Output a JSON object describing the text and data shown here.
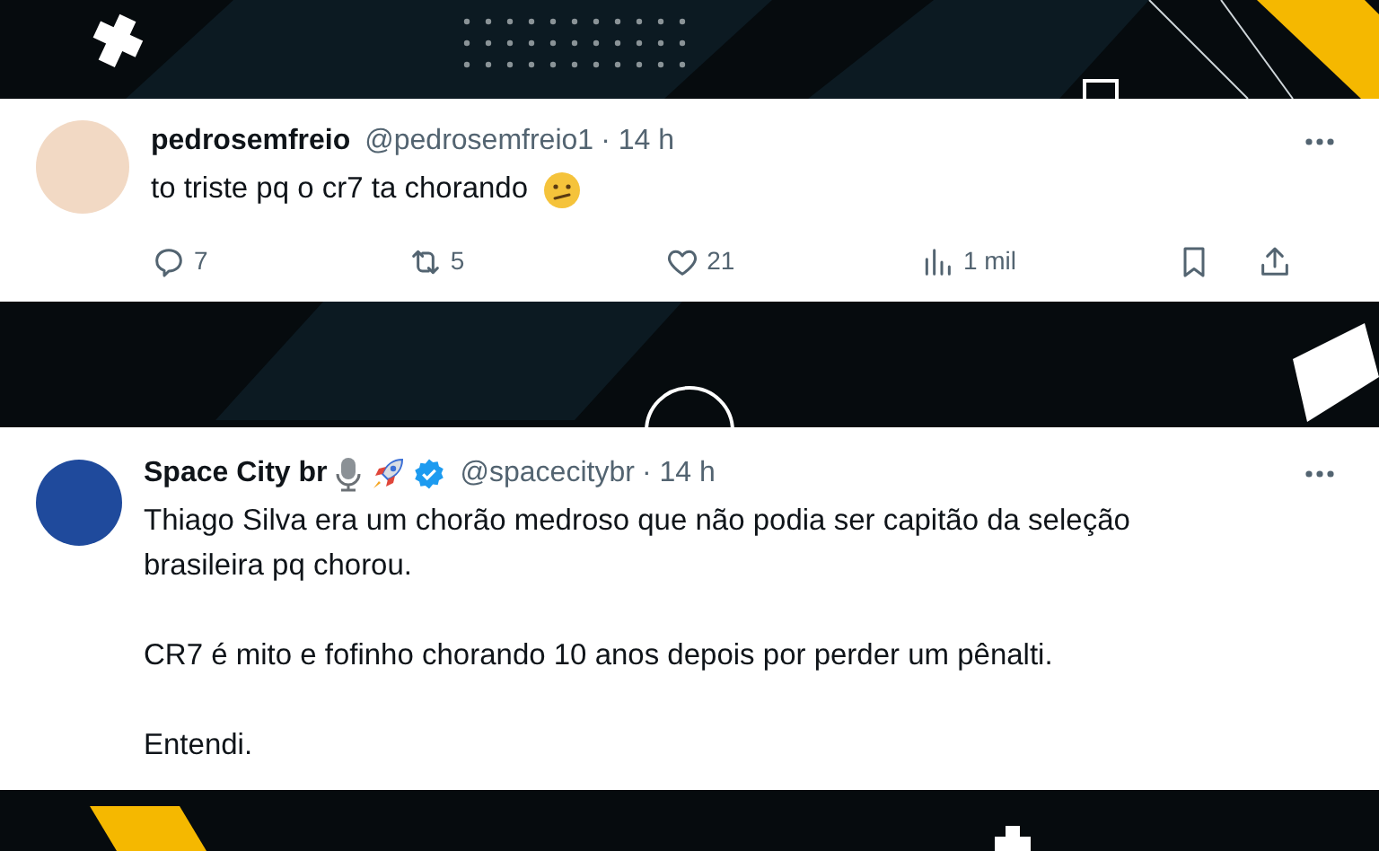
{
  "tweets": [
    {
      "name": "pedrosemfreio",
      "handle": "@pedrosemfreio1",
      "time": "· 14 h",
      "verified": false,
      "paragraphs": [
        "to triste pq o cr7 ta chorando"
      ],
      "actions": [
        {
          "kind": "reply",
          "count": "7"
        },
        {
          "kind": "retweet",
          "count": "5"
        },
        {
          "kind": "like",
          "count": "21"
        },
        {
          "kind": "views",
          "count": "1 mil"
        },
        {
          "kind": "bookmark"
        },
        {
          "kind": "share"
        }
      ]
    },
    {
      "name": "Space City br",
      "handle": "@spacecitybr",
      "time": "· 14 h",
      "verified": true,
      "paragraphs": [
        "Thiago Silva era um chorão medroso que não podia ser capitão da seleção brasileira pq chorou.",
        "CR7 é mito e fofinho chorando 10 anos depois por perder um pênalti.",
        "Entendi."
      ]
    }
  ]
}
